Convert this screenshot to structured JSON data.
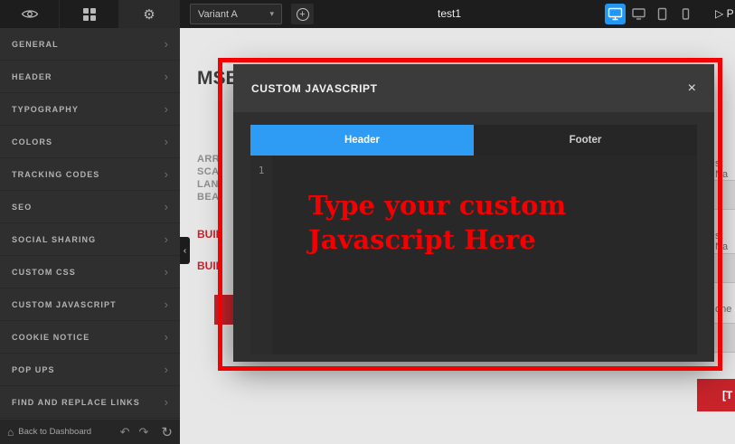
{
  "colors": {
    "accent_blue": "#2196f3",
    "brand_red": "#c9232b",
    "annotation_red": "#f40000"
  },
  "icons": {
    "gear": "⚙",
    "plus": "+",
    "chevron_down": "▾",
    "chevron_right": "›",
    "collapse_left": "‹",
    "close": "×",
    "home": "⌂",
    "undo": "↶",
    "redo": "↷",
    "refresh": "↻",
    "eye": "eye-icon",
    "grid": "grid-icon",
    "devices": [
      "desktop-icon",
      "monitor-icon",
      "tablet-icon",
      "mobile-icon"
    ]
  },
  "topbar": {
    "variant_label": "Variant A",
    "title": "test1",
    "preview_fragment": "▷ P"
  },
  "sidebar": {
    "items": [
      {
        "label": "GENERAL"
      },
      {
        "label": "HEADER"
      },
      {
        "label": "TYPOGRAPHY"
      },
      {
        "label": "COLORS"
      },
      {
        "label": "TRACKING CODES"
      },
      {
        "label": "SEO"
      },
      {
        "label": "SOCIAL SHARING"
      },
      {
        "label": "CUSTOM CSS"
      },
      {
        "label": "CUSTOM JAVASCRIPT"
      },
      {
        "label": "COOKIE NOTICE"
      },
      {
        "label": "POP UPS"
      },
      {
        "label": "FIND AND REPLACE LINKS"
      }
    ],
    "footer": {
      "back_label": "Back to Dashboard"
    }
  },
  "modal": {
    "title": "CUSTOM JAVASCRIPT",
    "tabs": [
      {
        "label": "Header",
        "active": true
      },
      {
        "label": "Footer",
        "active": false
      }
    ],
    "editor": {
      "line_number": "1"
    }
  },
  "annotation": {
    "lines": [
      "Type your custom",
      "Javascript Here"
    ]
  },
  "canvas": {
    "heading_fragment": "MSB",
    "tagline_fragments": [
      "ARR",
      "SCA",
      "LAN",
      "BEA"
    ],
    "red_fragments": [
      "BUIL",
      "BUIL"
    ],
    "form": {
      "first_name_fragment": "st Na",
      "last_name_fragment": "st Na",
      "phone_fragment": "one",
      "submit_fragment": "[T"
    }
  }
}
